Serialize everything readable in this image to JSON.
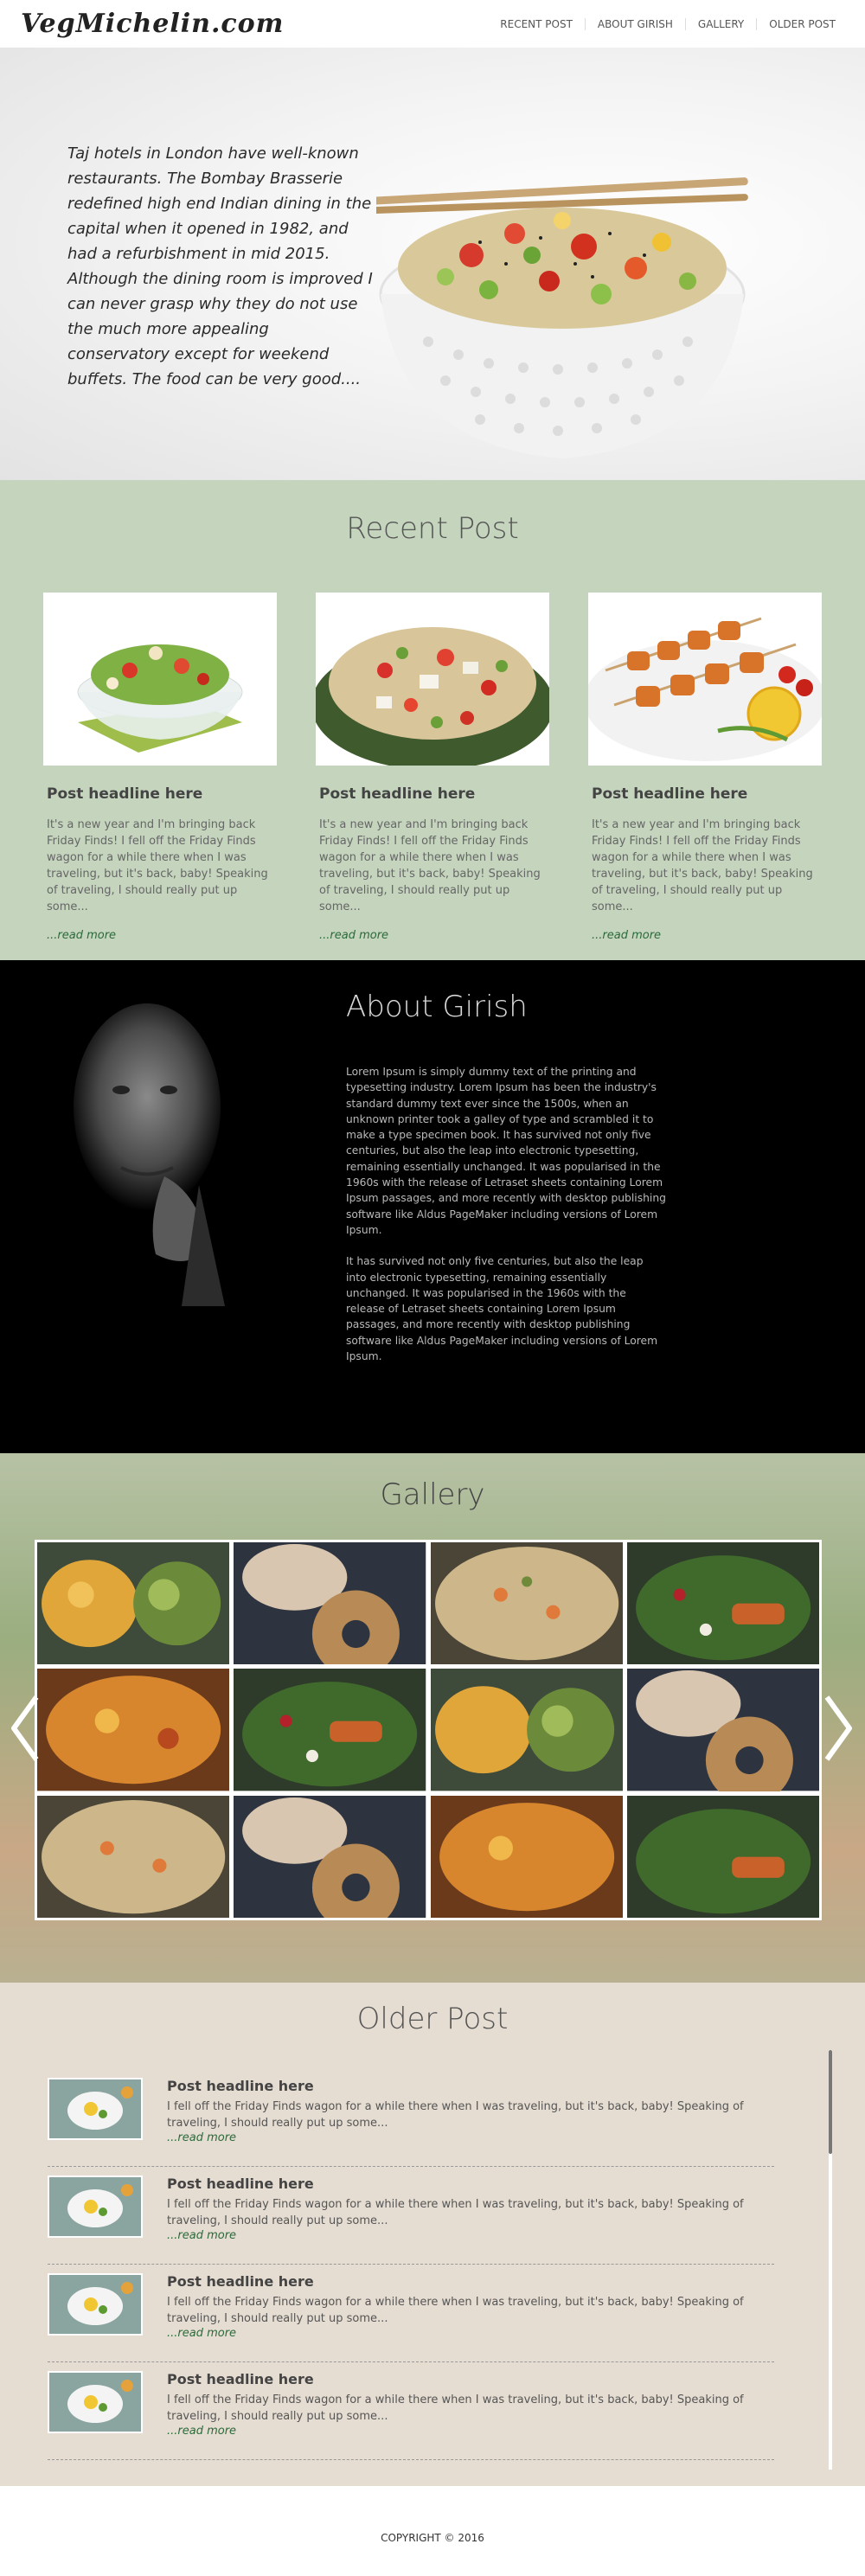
{
  "header": {
    "logo": "VegMichelin.com",
    "nav": [
      "RECENT POST",
      "ABOUT GIRISH",
      "GALLERY",
      "OLDER POST"
    ]
  },
  "hero": {
    "text": "Taj hotels in London have well-known restaurants. The Bombay Brasserie redefined high end Indian dining in the capital when it opened in 1982, and had a refurbishment in mid 2015. Although the dining room is improved I can never grasp why they do not use the much more appealing conservatory except for weekend buffets. The food can be very good...."
  },
  "recent": {
    "title": "Recent Post",
    "posts": [
      {
        "headline": "Post headline here",
        "excerpt": "It's a new year and I'm bringing back Friday Finds! I fell off the Friday Finds wagon for a while there when I was traveling, but it's back, baby! Speaking of traveling, I should really put up some...",
        "more": "...read more"
      },
      {
        "headline": "Post headline here",
        "excerpt": "It's a new year and I'm bringing back Friday Finds! I fell off the Friday Finds wagon for a while there when I was traveling, but it's back, baby! Speaking of traveling, I should really put up some...",
        "more": "...read more"
      },
      {
        "headline": "Post headline here",
        "excerpt": "It's a new year and I'm bringing back Friday Finds! I fell off the Friday Finds wagon for a while there when I was traveling, but it's back, baby! Speaking of traveling, I should really put up some...",
        "more": "...read more"
      }
    ]
  },
  "about": {
    "title": "About Girish",
    "paragraphs": [
      "Lorem Ipsum is simply dummy text of the printing and typesetting industry. Lorem Ipsum has been the industry's standard dummy text ever since the 1500s, when an unknown printer took a galley of type and scrambled it to make a type specimen book. It has survived not only five centuries, but also the leap into electronic typesetting, remaining essentially unchanged. It was popularised in the 1960s with the release of Letraset sheets containing Lorem Ipsum passages, and more recently with desktop publishing software like Aldus PageMaker including versions of Lorem Ipsum.",
      "It has survived not only five centuries, but also the leap into electronic typesetting, remaining essentially unchanged. It was popularised in the 1960s with the release of Letraset sheets containing Lorem Ipsum passages, and more recently with desktop publishing software like Aldus PageMaker including versions of Lorem Ipsum."
    ]
  },
  "gallery": {
    "title": "Gallery"
  },
  "older": {
    "title": "Older Post",
    "posts": [
      {
        "headline": "Post headline here",
        "excerpt": "I fell off the Friday Finds wagon for a while there when I was traveling, but it's back, baby! Speaking of traveling, I should really put up some...",
        "more": "...read more"
      },
      {
        "headline": "Post headline here",
        "excerpt": "I fell off the Friday Finds wagon for a while there when I was traveling, but it's back, baby! Speaking of traveling, I should really put up some...",
        "more": "...read more"
      },
      {
        "headline": "Post headline here",
        "excerpt": "I fell off the Friday Finds wagon for a while there when I was traveling, but it's back, baby! Speaking of traveling, I should really put up some...",
        "more": "...read more"
      },
      {
        "headline": "Post headline here",
        "excerpt": "I fell off the Friday Finds wagon for a while there when I was traveling, but it's back, baby! Speaking of traveling, I should really put up some...",
        "more": "...read more"
      }
    ]
  },
  "footer": {
    "copyright": "COPYRIGHT © 2016"
  }
}
